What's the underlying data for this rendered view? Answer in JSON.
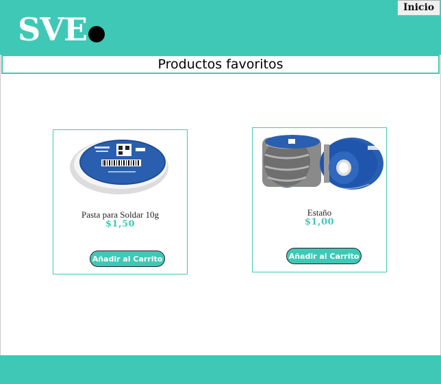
{
  "header": {
    "logo_text": "SVE",
    "nav_button": "Inicio"
  },
  "page_title": "Productos favoritos",
  "products": [
    {
      "name": "Pasta para Soldar 10g",
      "price": "$1,50",
      "button_label": "Añadir al Carrito"
    },
    {
      "name": "Estaño",
      "price": "$1,00",
      "button_label": "Añadir al Carrito"
    }
  ],
  "colors": {
    "accent": "#40c8b6",
    "background": "#ffffff",
    "text": "#222222"
  }
}
